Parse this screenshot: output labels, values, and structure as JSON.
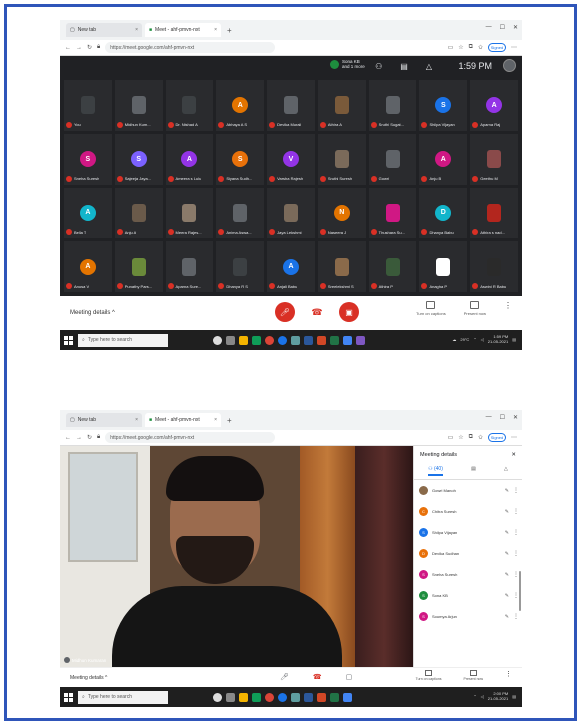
{
  "colors": {
    "frame": "#2f55b9",
    "meet_dark": "#202124",
    "end_call_red": "#d93025",
    "link_blue": "#1a73e8"
  },
  "screenshot_1": {
    "browser": {
      "tabs": [
        {
          "label": "New tab",
          "icon": "tab-icon"
        },
        {
          "label": "Meet - ahf-pmvn-nxt",
          "icon": "meet-icon"
        }
      ],
      "new_tab": "+",
      "url": "https://meet.google.com/ahf-pmvn-nxt",
      "profile": "Signed"
    },
    "meet": {
      "presenting": {
        "name": "Sona KB",
        "sub": "and 1 more"
      },
      "clock": "1:59 PM",
      "participants": [
        {
          "name": "You",
          "initial": "",
          "color": "#3c4043",
          "photo": true
        },
        {
          "name": "Midhun Kum...",
          "initial": "",
          "color": "#5f6368",
          "photo": true
        },
        {
          "name": "Dr. Nishad A",
          "initial": "",
          "color": "#3c4043",
          "photo": true
        },
        {
          "name": "Abhaya A S",
          "initial": "A",
          "color": "#e37400",
          "photo": false
        },
        {
          "name": "Devika Murali",
          "initial": "",
          "color": "#5f6368",
          "photo": true
        },
        {
          "name": "Athira A",
          "initial": "",
          "color": "#7a5a3a",
          "photo": true
        },
        {
          "name": "Sruthi Sugat...",
          "initial": "",
          "color": "#5f6368",
          "photo": true
        },
        {
          "name": "Shilpa Vijayan",
          "initial": "S",
          "color": "#1a73e8",
          "photo": false
        },
        {
          "name": "Aparna Raj",
          "initial": "A",
          "color": "#9334e6",
          "photo": false
        },
        {
          "name": "Sneha Suresh",
          "initial": "S",
          "color": "#d01884",
          "photo": false
        },
        {
          "name": "Sajeeja Jaya...",
          "initial": "S",
          "color": "#7b61ff",
          "photo": false
        },
        {
          "name": "Ameera s Lulu",
          "initial": "A",
          "color": "#9334e6",
          "photo": false
        },
        {
          "name": "Siyana Sudh...",
          "initial": "S",
          "color": "#e8710a",
          "photo": false
        },
        {
          "name": "Varsha Rajesh",
          "initial": "V",
          "color": "#9334e6",
          "photo": false
        },
        {
          "name": "Sruthi Suresh",
          "initial": "",
          "color": "#7a6a5a",
          "photo": true
        },
        {
          "name": "Gowri",
          "initial": "",
          "color": "#5f6368",
          "photo": true
        },
        {
          "name": "Anju B",
          "initial": "A",
          "color": "#d01884",
          "photo": false
        },
        {
          "name": "Geethu M",
          "initial": "",
          "color": "#8a4a4a",
          "photo": true
        },
        {
          "name": "Bella T",
          "initial": "A",
          "color": "#12b5cb",
          "photo": false
        },
        {
          "name": "Anju A",
          "initial": "",
          "color": "#6a5a4a",
          "photo": true
        },
        {
          "name": "Meera Rajes...",
          "initial": "",
          "color": "#8a7a6a",
          "photo": true
        },
        {
          "name": "Anima Aswa...",
          "initial": "",
          "color": "#5f6368",
          "photo": true
        },
        {
          "name": "Jaya Lekshmi",
          "initial": "",
          "color": "#7a6a5a",
          "photo": true
        },
        {
          "name": "Naseera J",
          "initial": "N",
          "color": "#e37400",
          "photo": false
        },
        {
          "name": "Thushara Su...",
          "initial": "",
          "color": "#d01884",
          "photo": true
        },
        {
          "name": "Dhanya Babu",
          "initial": "D",
          "color": "#12b5cb",
          "photo": false
        },
        {
          "name": "Athira s nad...",
          "initial": "",
          "color": "#b3261e",
          "photo": true
        },
        {
          "name": "Anusa V",
          "initial": "A",
          "color": "#e37400",
          "photo": false
        },
        {
          "name": "Punathy Pars...",
          "initial": "",
          "color": "#6a8a3a",
          "photo": true
        },
        {
          "name": "Aparna Sure...",
          "initial": "",
          "color": "#5f6368",
          "photo": true
        },
        {
          "name": "Dhanya R S",
          "initial": "",
          "color": "#3c4043",
          "photo": true
        },
        {
          "name": "Anjali Babu",
          "initial": "A",
          "color": "#1a73e8",
          "photo": false
        },
        {
          "name": "Sreelekshmi S",
          "initial": "",
          "color": "#8a6a4a",
          "photo": true
        },
        {
          "name": "Athira P",
          "initial": "",
          "color": "#3a5a3a",
          "photo": true
        },
        {
          "name": "Anagha P",
          "initial": "",
          "color": "#ffffff",
          "photo": true
        },
        {
          "name": "Aswini R Babu",
          "initial": "",
          "color": "#2a2a2a",
          "photo": true
        }
      ],
      "meeting_details": "Meeting details",
      "turn_on_captions": "Turn on captions",
      "present_now": "Present now"
    },
    "taskbar": {
      "search_placeholder": "Type here to search",
      "time": "1:59 PM",
      "date": "21-05-2021",
      "temp": "29°C"
    }
  },
  "screenshot_2": {
    "browser": {
      "tabs": [
        {
          "label": "New tab",
          "icon": "tab-icon"
        },
        {
          "label": "Meet - ahf-pmvn-nxt",
          "icon": "meet-icon"
        }
      ],
      "new_tab": "+",
      "url": "https://meet.google.com/ahf-pmvn-nxt",
      "profile": "Signed"
    },
    "video": {
      "speaker_name": "Midhun Kumaran"
    },
    "panel": {
      "title": "Meeting details",
      "tab_people_count": "(40)",
      "participants": [
        {
          "name": "Gowri Manoh",
          "initial": "",
          "color": "#8a6a4a"
        },
        {
          "name": "Chitra Suresh",
          "initial": "C",
          "color": "#e8710a"
        },
        {
          "name": "Shilpa Vijayan",
          "initial": "S",
          "color": "#1a73e8"
        },
        {
          "name": "Devika Sudhan",
          "initial": "D",
          "color": "#e8710a"
        },
        {
          "name": "Sneha Suresh",
          "initial": "S",
          "color": "#d01884"
        },
        {
          "name": "Sona KB",
          "initial": "S",
          "color": "#1e8e3e"
        },
        {
          "name": "Soumya Arjun",
          "initial": "S",
          "color": "#d01884"
        }
      ]
    },
    "meeting_details": "Meeting details",
    "turn_on_captions": "Turn on captions",
    "present_now": "Present now",
    "taskbar": {
      "search_placeholder": "Type here to search",
      "time": "2:00 PM",
      "date": "21-05-2021"
    }
  }
}
